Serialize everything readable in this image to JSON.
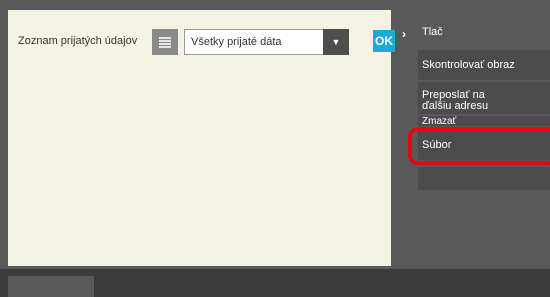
{
  "filter": {
    "label": "Zoznam prijatých údajov",
    "list_icon": "list-icon",
    "selected_option": "Všetky prijaté dáta",
    "dropdown_icon": "triangle-down-icon"
  },
  "ok_label": "OK",
  "side_menu": {
    "chevron_icon": "chevron-right-icon",
    "items": [
      {
        "label": "Tlač"
      },
      {
        "label": "Skontrolovať obraz"
      },
      {
        "label_line1": "Preposlať na",
        "label_line2": "ďalšiu adresu"
      },
      {
        "label": "Zmazať"
      },
      {
        "label": "Súbor"
      }
    ]
  },
  "colors": {
    "panel": "#f5f3e3",
    "background": "#595959",
    "ok_button": "#1cabd9",
    "highlight": "#e30613"
  }
}
